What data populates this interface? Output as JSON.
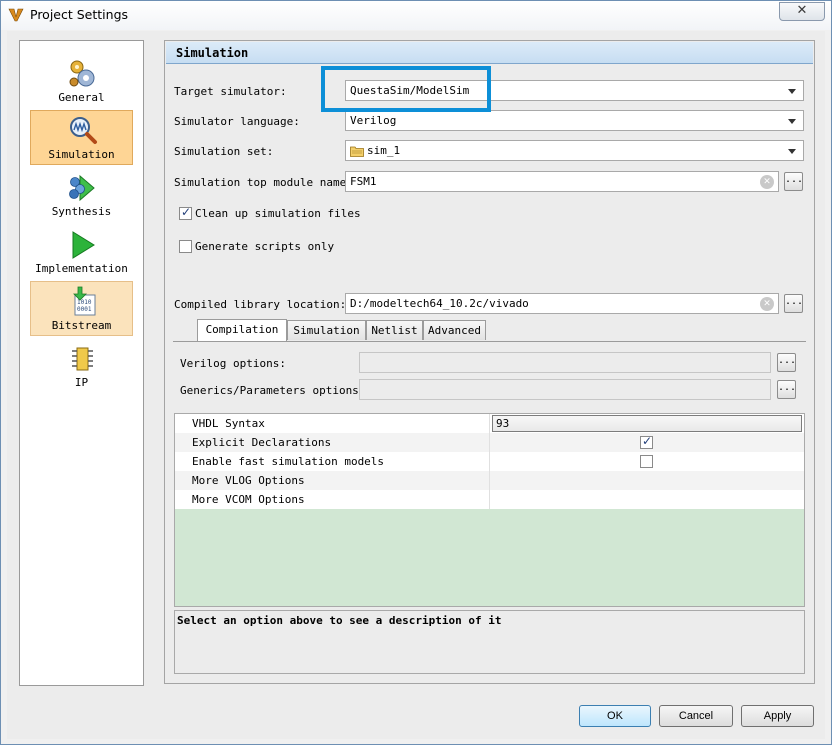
{
  "window": {
    "title": "Project Settings",
    "close_glyph": "✕"
  },
  "sidebar": {
    "items": [
      {
        "label": "General",
        "icon": "general-gears-icon",
        "state": "normal"
      },
      {
        "label": "Simulation",
        "icon": "simulation-magnifier-icon",
        "state": "selected"
      },
      {
        "label": "Synthesis",
        "icon": "synthesis-icon",
        "state": "normal"
      },
      {
        "label": "Implementation",
        "icon": "implementation-play-icon",
        "state": "normal"
      },
      {
        "label": "Bitstream",
        "icon": "bitstream-icon",
        "state": "pressed"
      },
      {
        "label": "IP",
        "icon": "ip-chip-icon",
        "state": "normal"
      }
    ]
  },
  "section": {
    "title": "Simulation"
  },
  "form": {
    "target_simulator": {
      "label": "Target simulator:",
      "value": "QuestaSim/ModelSim"
    },
    "simulator_language": {
      "label": "Simulator language:",
      "value": "Verilog"
    },
    "simulation_set": {
      "label": "Simulation set:",
      "value": "sim_1"
    },
    "top_module": {
      "label": "Simulation top module name:",
      "value": "FSM1"
    },
    "clean_up": {
      "label": "Clean up simulation files",
      "checked": true
    },
    "generate_scripts": {
      "label": "Generate scripts only",
      "checked": false
    },
    "compiled_library": {
      "label": "Compiled library location:",
      "value": "D:/modeltech64_10.2c/vivado"
    },
    "browse_label": "..."
  },
  "tabs": [
    {
      "label": "Compilation",
      "active": true
    },
    {
      "label": "Simulation",
      "active": false
    },
    {
      "label": "Netlist",
      "active": false
    },
    {
      "label": "Advanced",
      "active": false
    }
  ],
  "compilation": {
    "verilog_options": {
      "label": "Verilog options:",
      "value": ""
    },
    "generics_parameters": {
      "label": "Generics/Parameters options:",
      "value": ""
    },
    "properties": [
      {
        "name": "VHDL Syntax",
        "value": "93",
        "kind": "combo"
      },
      {
        "name": "Explicit Declarations",
        "checked": true,
        "kind": "checkbox"
      },
      {
        "name": "Enable fast simulation models",
        "checked": false,
        "kind": "checkbox"
      },
      {
        "name": "More VLOG Options",
        "value": "",
        "kind": "text"
      },
      {
        "name": "More VCOM Options",
        "value": "",
        "kind": "text"
      }
    ],
    "description": "Select an option above to see a description of it"
  },
  "buttons": {
    "ok": "OK",
    "cancel": "Cancel",
    "apply": "Apply"
  },
  "colors": {
    "highlight": "#0d8fd7",
    "selected_bg": "#fed595",
    "header_bg": "#c6ddf2",
    "table_bg": "#d1e7d3"
  }
}
